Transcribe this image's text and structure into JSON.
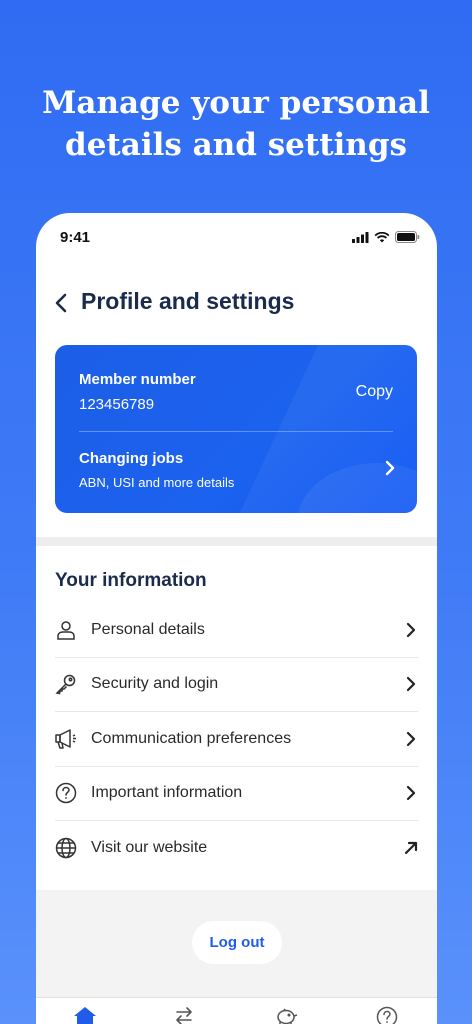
{
  "headline": {
    "line1": "Manage your personal",
    "line2": "details and settings"
  },
  "status_bar": {
    "time": "9:41"
  },
  "nav": {
    "title": "Profile and settings"
  },
  "member_card": {
    "label": "Member number",
    "number": "123456789",
    "copy_label": "Copy",
    "changing_jobs_title": "Changing jobs",
    "changing_jobs_subtitle": "ABN, USI and more details"
  },
  "your_information": {
    "title": "Your information",
    "items": [
      {
        "label": "Personal details",
        "icon": "person-icon",
        "trailing": "chevron-right-icon"
      },
      {
        "label": "Security and login",
        "icon": "key-icon",
        "trailing": "chevron-right-icon"
      },
      {
        "label": "Communication preferences",
        "icon": "megaphone-icon",
        "trailing": "chevron-right-icon"
      },
      {
        "label": "Important information",
        "icon": "question-circle-icon",
        "trailing": "chevron-right-icon"
      },
      {
        "label": "Visit our website",
        "icon": "globe-icon",
        "trailing": "external-link-icon"
      }
    ]
  },
  "logout": {
    "label": "Log out"
  },
  "tab_bar": {
    "tabs": [
      {
        "icon": "home-icon",
        "active": true
      },
      {
        "icon": "transfer-icon",
        "active": false
      },
      {
        "icon": "piggy-bank-icon",
        "active": false
      },
      {
        "icon": "help-icon",
        "active": false
      }
    ]
  },
  "colors": {
    "accent": "#1f5de8",
    "title": "#1a2b4b",
    "background": "#3573f4"
  }
}
